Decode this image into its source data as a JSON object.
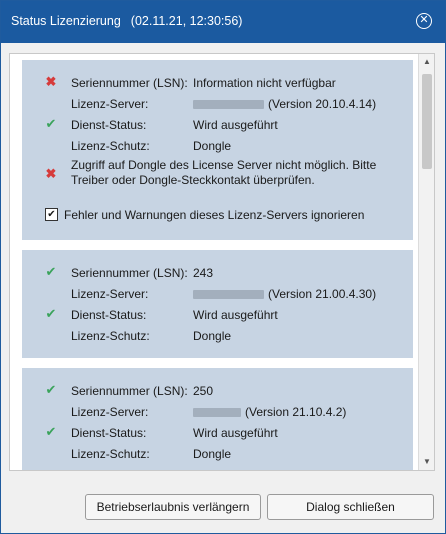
{
  "dialog": {
    "title": "Status Lizenzierung",
    "timestamp": "(02.11.21, 12:30:56)",
    "close_icon": "x"
  },
  "servers": [
    {
      "serial_label": "Seriennummer (LSN):",
      "serial_value": "Information nicht verfügbar",
      "serial_status": "error",
      "server_label": "Lizenz-Server:",
      "server_version": "(Version 20.10.4.14)",
      "service_label": "Dienst-Status:",
      "service_value": "Wird ausgeführt",
      "service_status": "ok",
      "protection_label": "Lizenz-Schutz:",
      "protection_value": "Dongle",
      "error_message": "Zugriff auf Dongle des License Server nicht möglich. Bitte Treiber oder Dongle-Steckkontakt überprüfen.",
      "ignore_checkbox_label": "Fehler und Warnungen dieses Lizenz-Servers ignorieren",
      "ignore_checked": true
    },
    {
      "serial_label": "Seriennummer (LSN):",
      "serial_value": "243",
      "serial_status": "ok",
      "server_label": "Lizenz-Server:",
      "server_version": "(Version 21.00.4.30)",
      "service_label": "Dienst-Status:",
      "service_value": "Wird ausgeführt",
      "service_status": "ok",
      "protection_label": "Lizenz-Schutz:",
      "protection_value": "Dongle"
    },
    {
      "serial_label": "Seriennummer (LSN):",
      "serial_value": "250",
      "serial_status": "ok",
      "server_label": "Lizenz-Server:",
      "server_version": "(Version 21.10.4.2)",
      "service_label": "Dienst-Status:",
      "service_value": "Wird ausgeführt",
      "service_status": "ok",
      "protection_label": "Lizenz-Schutz:",
      "protection_value": "Dongle"
    }
  ],
  "buttons": {
    "extend": "Betriebserlaubnis verlängern",
    "close": "Dialog schließen"
  },
  "icons": {
    "ok": "check-icon",
    "error": "cross-icon",
    "colors": {
      "ok": "#3aa35b",
      "error": "#d63b3b",
      "titlebar": "#1b5aa0",
      "panel": "#c7d4e3"
    }
  }
}
